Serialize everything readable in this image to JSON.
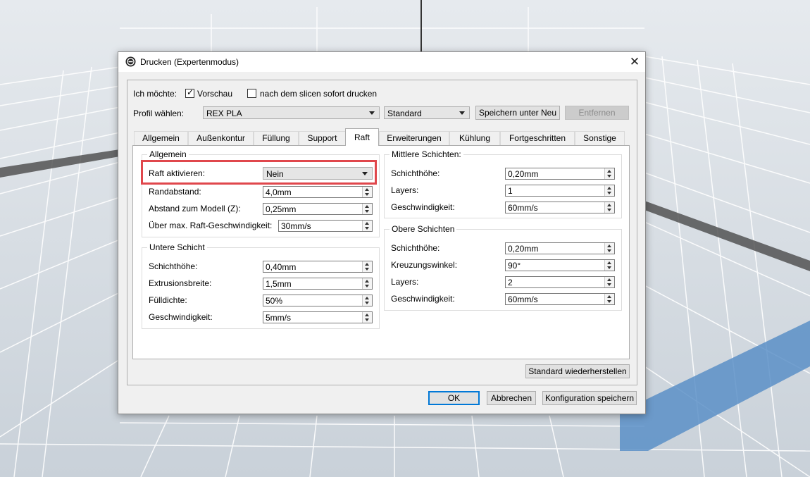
{
  "dialog": {
    "title": "Drucken (Expertenmodus)",
    "close_glyph": "✕"
  },
  "options": {
    "ich_moechte_label": "Ich möchte:",
    "vorschau_label": "Vorschau",
    "vorschau_checked": true,
    "slice_print_label": "nach dem slicen sofort drucken",
    "slice_print_checked": false
  },
  "profile": {
    "label": "Profil wählen:",
    "value": "REX PLA",
    "quality_value": "Standard",
    "save_as_label": "Speichern unter Neu",
    "remove_label": "Entfernen"
  },
  "tabs": [
    {
      "label": "Allgemein"
    },
    {
      "label": "Außenkontur"
    },
    {
      "label": "Füllung"
    },
    {
      "label": "Support"
    },
    {
      "label": "Raft",
      "active": true
    },
    {
      "label": "Erweiterungen"
    },
    {
      "label": "Kühlung"
    },
    {
      "label": "Fortgeschritten"
    },
    {
      "label": "Sonstige"
    }
  ],
  "allgemein": {
    "title": "Allgemein",
    "raft_label": "Raft aktivieren:",
    "raft_value": "Nein",
    "rand_label": "Randabstand:",
    "rand_value": "4,0mm",
    "abstand_label": "Abstand zum Modell (Z):",
    "abstand_value": "0,25mm",
    "speed_label": "Über max. Raft-Geschwindigkeit:",
    "speed_value": "30mm/s"
  },
  "untere": {
    "title": "Untere Schicht",
    "fields": [
      {
        "label": "Schichthöhe:",
        "value": "0,40mm"
      },
      {
        "label": "Extrusionsbreite:",
        "value": "1,5mm"
      },
      {
        "label": "Fülldichte:",
        "value": "50%"
      },
      {
        "label": "Geschwindigkeit:",
        "value": "5mm/s"
      }
    ]
  },
  "mittlere": {
    "title": "Mittlere Schichten:",
    "fields": [
      {
        "label": "Schichthöhe:",
        "value": "0,20mm"
      },
      {
        "label": "Layers:",
        "value": "1"
      },
      {
        "label": "Geschwindigkeit:",
        "value": "60mm/s"
      }
    ]
  },
  "obere": {
    "title": "Obere Schichten",
    "fields": [
      {
        "label": "Schichthöhe:",
        "value": "0,20mm"
      },
      {
        "label": "Kreuzungswinkel:",
        "value": "90°"
      },
      {
        "label": "Layers:",
        "value": "2"
      },
      {
        "label": "Geschwindigkeit:",
        "value": "60mm/s"
      }
    ]
  },
  "buttons": {
    "restore": "Standard wiederherstellen",
    "ok": "OK",
    "cancel": "Abbrechen",
    "save_config": "Konfiguration speichern"
  },
  "colors": {
    "highlight": "#e0474c",
    "default_button_border": "#0078d7",
    "build_plate": "#d6dde4",
    "build_plate_band": "#5b8fc7"
  }
}
